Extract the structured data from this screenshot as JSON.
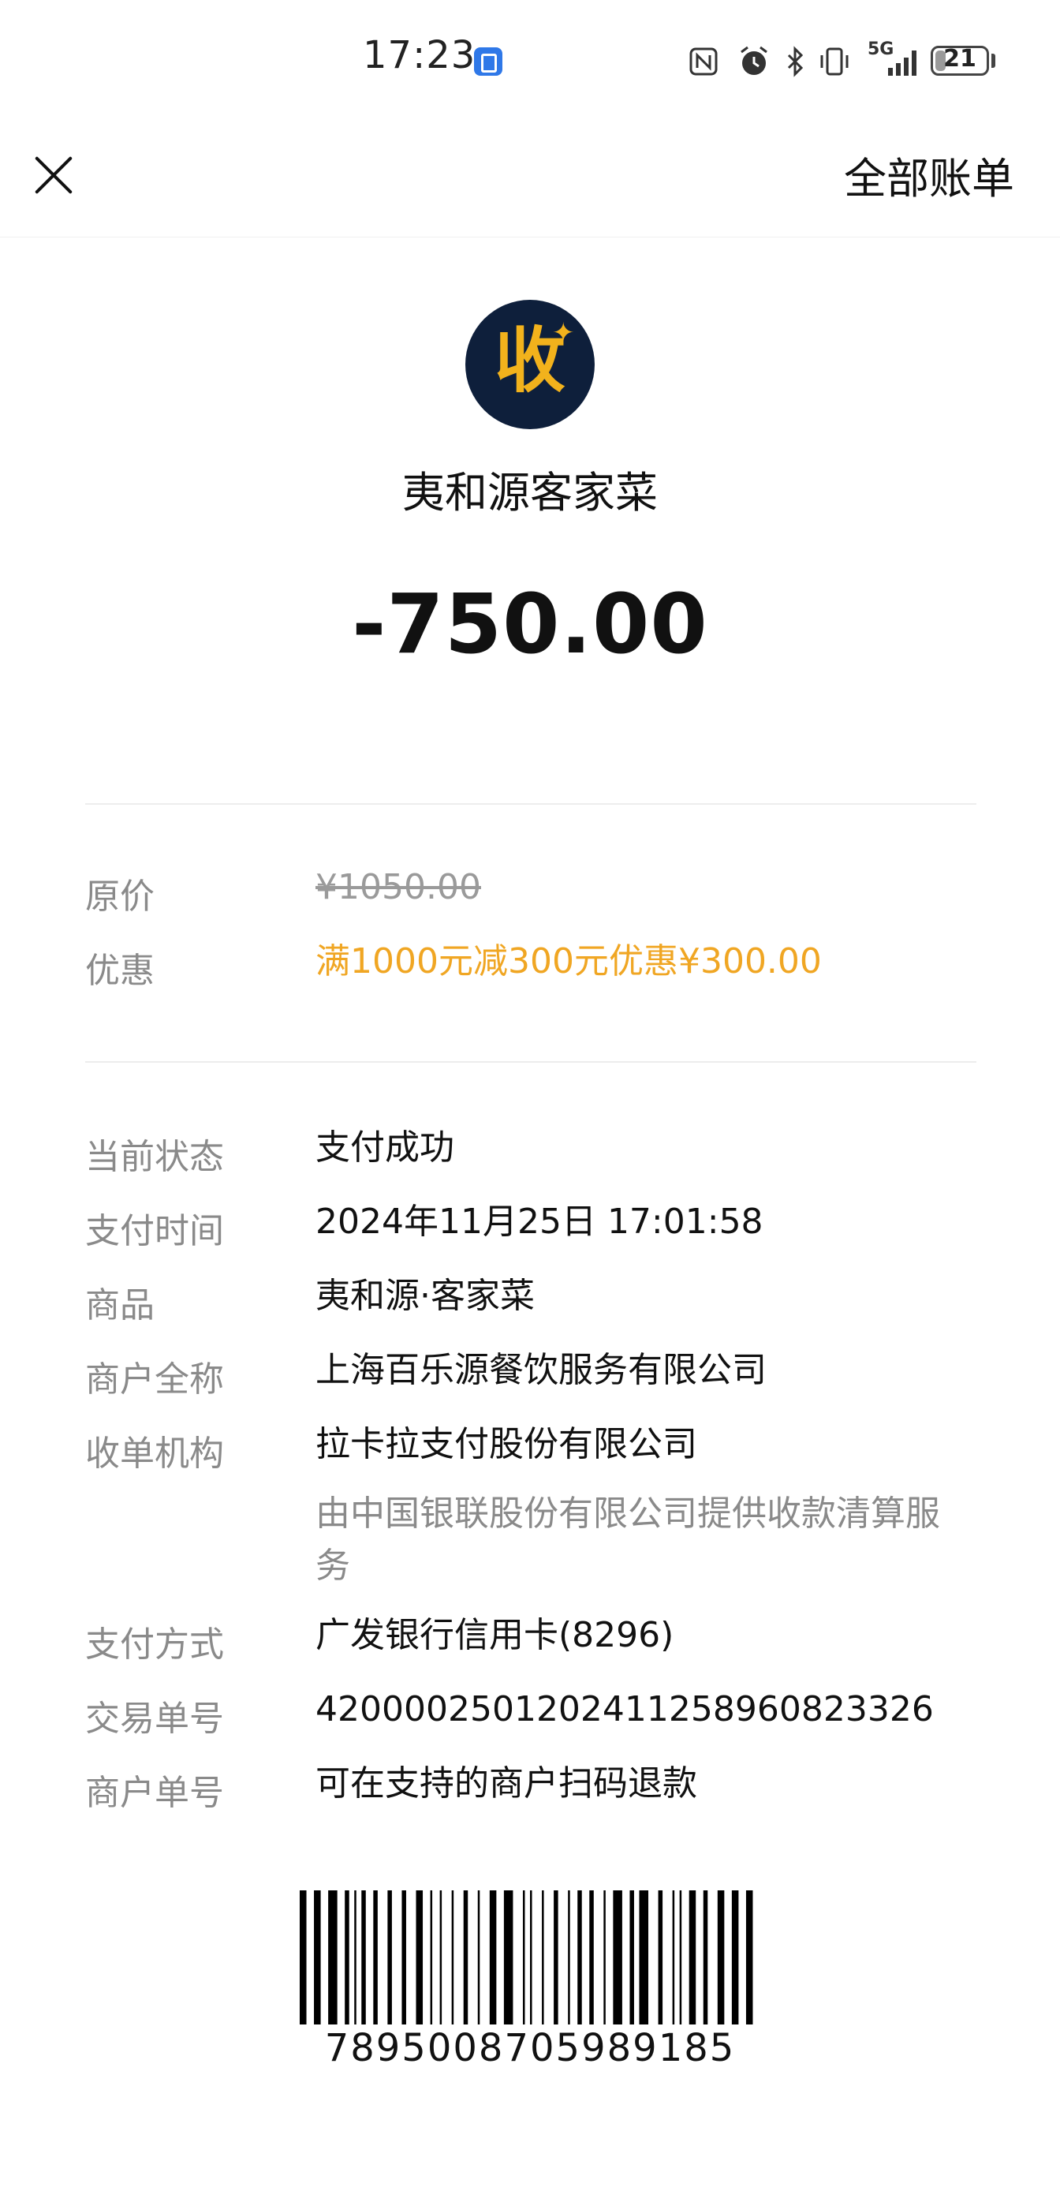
{
  "status_bar": {
    "time": "17:23",
    "network": "5G",
    "battery": "21",
    "battery_level": 0.21,
    "icons": [
      "app-notification-icon",
      "nfc-icon",
      "alarm-icon",
      "bluetooth-icon",
      "vibrate-icon",
      "signal-icon",
      "battery-icon"
    ]
  },
  "header": {
    "close_icon": "close-icon",
    "all_bills_label": "全部账单"
  },
  "merchant": {
    "logo_char": "收",
    "logo_bg_color": "#0e1f3b",
    "logo_fg_color": "#f2b21c",
    "name": "夷和源客家菜"
  },
  "amount": "-750.00",
  "pricing": {
    "original_label": "原价",
    "original_value": "¥1050.00",
    "discount_label": "优惠",
    "discount_value": "满1000元减300元优惠¥300.00",
    "discount_color": "#f0a623"
  },
  "details": {
    "status_label": "当前状态",
    "status_value": "支付成功",
    "time_label": "支付时间",
    "time_value": "2024年11月25日 17:01:58",
    "goods_label": "商品",
    "goods_value": "夷和源·客家菜",
    "merchant_full_label": "商户全称",
    "merchant_full_value": "上海百乐源餐饮服务有限公司",
    "acquirer_label": "收单机构",
    "acquirer_value": "拉卡拉支付股份有限公司",
    "acquirer_note": "由中国银联股份有限公司提供收款清算服务",
    "pay_method_label": "支付方式",
    "pay_method_value": "广发银行信用卡(8296)",
    "txn_no_label": "交易单号",
    "txn_no_value": "4200002501202411258960823326",
    "merchant_no_label": "商户单号",
    "merchant_no_value": "可在支持的商户扫码退款"
  },
  "barcode": {
    "number": "7895008705989185"
  }
}
